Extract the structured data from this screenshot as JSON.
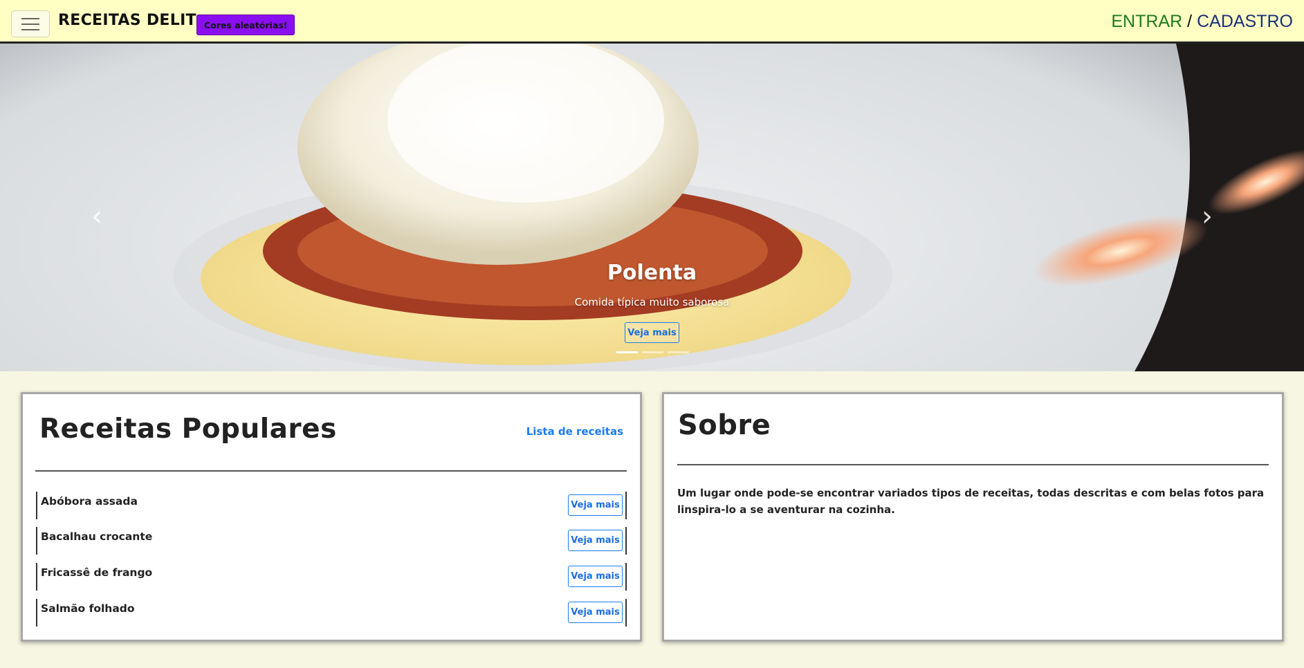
{
  "navbar": {
    "brand": "RECEITAS DELIT",
    "random_colors_label": "Cores aleatórias!",
    "login_label": "ENTRAR",
    "separator": "/",
    "signup_label": "CADASTRO"
  },
  "carousel": {
    "title": "Polenta",
    "subtitle": "Comida típica muito saborosa",
    "button_label": "Veja mais",
    "prev_icon": "‹",
    "next_icon": "›",
    "slides": 3,
    "active_slide": 1
  },
  "popular": {
    "title": "Receitas Populares",
    "list_link": "Lista de receitas",
    "items": [
      {
        "name": "Abóbora assada",
        "button": "Veja mais"
      },
      {
        "name": "Bacalhau crocante",
        "button": "Veja mais"
      },
      {
        "name": "Fricassê de frango",
        "button": "Veja mais"
      },
      {
        "name": "Salmão folhado",
        "button": "Veja mais"
      }
    ]
  },
  "about": {
    "title": "Sobre",
    "text": "Um lugar onde pode-se encontrar variados tipos de receitas, todas descritas e com belas fotos para linspira-lo a se aventurar na cozinha."
  },
  "colors": {
    "navbar_bg": "#ffffc4",
    "page_bg": "#f6f6e2",
    "accent_purple": "#8a0ff0",
    "login_green": "#1f7a1f",
    "signup_blue": "#1a2f7a",
    "link_blue": "#1a7cf0"
  }
}
